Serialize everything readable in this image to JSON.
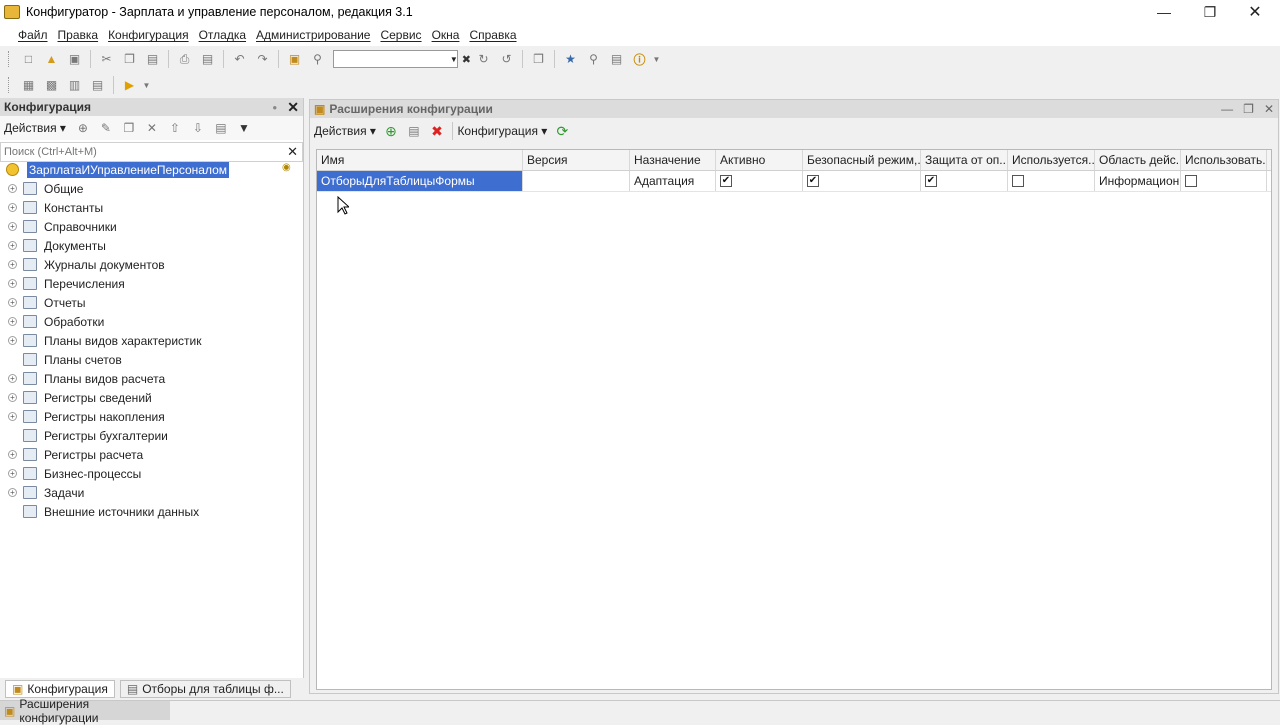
{
  "window": {
    "title": "Конфигуратор - Зарплата и управление персоналом, редакция 3.1"
  },
  "menu": [
    "Файл",
    "Правка",
    "Конфигурация",
    "Отладка",
    "Администрирование",
    "Сервис",
    "Окна",
    "Справка"
  ],
  "left_panel": {
    "title": "Конфигурация",
    "actions_label": "Действия",
    "search_placeholder": "Поиск (Ctrl+Alt+M)",
    "root": "ЗарплатаИУправлениеПерсоналом",
    "items": [
      {
        "label": "Общие",
        "expand": true,
        "icon": "common-icon"
      },
      {
        "label": "Константы",
        "expand": true,
        "icon": "constants-icon"
      },
      {
        "label": "Справочники",
        "expand": true,
        "icon": "catalogs-icon"
      },
      {
        "label": "Документы",
        "expand": true,
        "icon": "documents-icon"
      },
      {
        "label": "Журналы документов",
        "expand": true,
        "icon": "document-journals-icon"
      },
      {
        "label": "Перечисления",
        "expand": true,
        "icon": "enums-icon"
      },
      {
        "label": "Отчеты",
        "expand": true,
        "icon": "reports-icon"
      },
      {
        "label": "Обработки",
        "expand": true,
        "icon": "data-processors-icon"
      },
      {
        "label": "Планы видов характеристик",
        "expand": true,
        "icon": "chart-of-characteristics-icon"
      },
      {
        "label": "Планы счетов",
        "expand": false,
        "icon": "chart-of-accounts-icon"
      },
      {
        "label": "Планы видов расчета",
        "expand": true,
        "icon": "chart-of-calculation-icon"
      },
      {
        "label": "Регистры сведений",
        "expand": true,
        "icon": "information-registers-icon"
      },
      {
        "label": "Регистры накопления",
        "expand": true,
        "icon": "accumulation-registers-icon"
      },
      {
        "label": "Регистры бухгалтерии",
        "expand": false,
        "icon": "accounting-registers-icon"
      },
      {
        "label": "Регистры расчета",
        "expand": true,
        "icon": "calculation-registers-icon"
      },
      {
        "label": "Бизнес-процессы",
        "expand": true,
        "icon": "business-processes-icon"
      },
      {
        "label": "Задачи",
        "expand": true,
        "icon": "tasks-icon"
      },
      {
        "label": "Внешние источники данных",
        "expand": false,
        "icon": "external-data-sources-icon"
      }
    ],
    "bottom_tabs": [
      "Конфигурация",
      "Отборы для таблицы ф..."
    ]
  },
  "ext_window": {
    "title": "Расширения конфигурации",
    "actions_label": "Действия",
    "config_label": "Конфигурация",
    "columns": [
      "Имя",
      "Версия",
      "Назначение",
      "Активно",
      "Безопасный режим,...",
      "Защита от оп...",
      "Используется...",
      "Область дейс...",
      "Использовать..."
    ],
    "rows": [
      {
        "name": "ОтборыДляТаблицыФормы",
        "version": "",
        "purpose": "Адаптация",
        "active": true,
        "safe_mode": true,
        "protection": true,
        "used": false,
        "scope": "Информацион...",
        "use": false
      }
    ]
  },
  "status_tab": "Расширения конфигурации"
}
